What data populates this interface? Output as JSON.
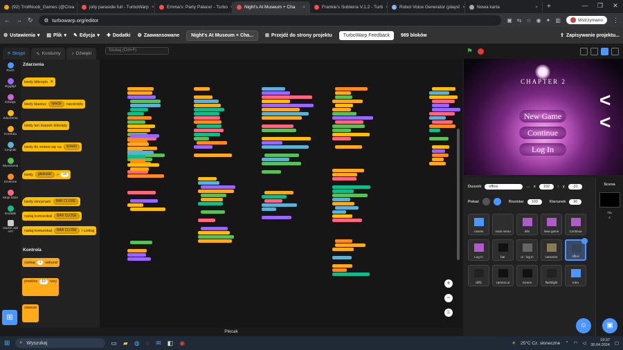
{
  "browser": {
    "tabs": [
      {
        "label": "(92) TrollNoob_Games (@Crea",
        "color": "#f4a300"
      },
      {
        "label": "jolly paraside full - TurboWarp",
        "color": "#ff4c4c"
      },
      {
        "label": "Emma's: Party Palace! - Turbo",
        "color": "#ff4c4c"
      },
      {
        "label": "Night's At Museum + Cha",
        "color": "#ff4c4c"
      },
      {
        "label": "Frankie's Subterra V.1.2 - Turb",
        "color": "#ff4c4c"
      },
      {
        "label": "Robot Voice Generator (playst",
        "color": "#8ab4f8"
      },
      {
        "label": "Nowa karta",
        "color": "#aaaaaa"
      }
    ],
    "tab_close": "×",
    "new_tab": "+",
    "url": "turbowarp.org/editor",
    "profile_label": "Wstrzymano",
    "window_controls": [
      "—",
      "❐",
      "✕"
    ]
  },
  "menubar": {
    "settings": "Ustawienia",
    "file": "Plik",
    "edit": "Edycja",
    "addons": "Dodatki",
    "advanced": "Zaawansowane",
    "project_title": "Night's At Museum + Cha...",
    "project_page": "Przejdź do strony projektu",
    "feedback": "TurboWarp Feedback",
    "block_count": "989 bloków",
    "save": "Zapisywanie projektu..."
  },
  "editor_tabs": {
    "code": "Skrypt",
    "costumes": "Kostiumy",
    "sounds": "Dźwięki"
  },
  "search_placeholder": "Szukaj (Ctrl+F)",
  "categories": [
    {
      "label": "Ruch",
      "color": "#4c97ff"
    },
    {
      "label": "Wygląd",
      "color": "#9966ff"
    },
    {
      "label": "Dźwięk",
      "color": "#cf63cf"
    },
    {
      "label": "Zdarzenia",
      "color": "#ffbf00"
    },
    {
      "label": "Kontrola",
      "color": "#ffab19"
    },
    {
      "label": "Czujniki",
      "color": "#5cb1d6"
    },
    {
      "label": "Wyrażenia",
      "color": "#59c059"
    },
    {
      "label": "Zmienne",
      "color": "#ff8c1a"
    },
    {
      "label": "Moje bloki",
      "color": "#ff6680"
    },
    {
      "label": "Dodatki",
      "color": "#0fbd8c"
    },
    {
      "label": "Game Jolt API",
      "color": "#cccccc"
    }
  ],
  "palette": {
    "events_title": "Zdarzenia",
    "control_title": "Kontrola",
    "when_flag": "kiedy kliknięto",
    "when_key": "kiedy klawisz",
    "key_value": "spacja",
    "key_pressed": "naciśnięty",
    "when_sprite_clicked": "kiedy ten duszek kliknięty",
    "when_backdrop": "kiedy tło zmieni się na",
    "backdrop_value": "screen",
    "when_greater": "kiedy",
    "loudness": "głośność",
    "greater_sign": ">",
    "greater_value": "10",
    "when_receive": "kiedy otrzymam",
    "broadcast_value": "BAR CLOSE",
    "broadcast": "nadaj komunikat",
    "broadcast_wait": "nadaj komunikat",
    "and_wait": "i czekaj",
    "wait": "czekaj",
    "wait_value": "1",
    "seconds": "sekund",
    "repeat": "powtórz",
    "repeat_value": "10",
    "times": "razy",
    "forever": "zawsze"
  },
  "stage": {
    "chapter": "CHAPTER 2",
    "new_game": "New Game",
    "continue": "Continue",
    "login": "Log In",
    "chevrons": [
      "<",
      "<"
    ]
  },
  "sprite_info": {
    "sprite_label": "Duszek",
    "sprite_name": "office",
    "x_label": "x",
    "x_value": "102",
    "y_label": "y",
    "y_value": "-31",
    "show_label": "Pokaż",
    "size_label": "Rozmiar",
    "size_value": "100",
    "direction_label": "Kierunek",
    "direction_value": "90"
  },
  "sprites": [
    {
      "name": "Assets",
      "color": "#4c97ff",
      "selected": false
    },
    {
      "name": "main menu",
      "color": "#2e2e2e",
      "selected": false
    },
    {
      "name": "title",
      "color": "#b05cc8",
      "selected": false
    },
    {
      "name": "New game",
      "color": "#b05cc8",
      "selected": false
    },
    {
      "name": "Continue",
      "color": "#b05cc8",
      "selected": false
    },
    {
      "name": "Log In",
      "color": "#b05cc8",
      "selected": false
    },
    {
      "name": "bar",
      "color": "#111111",
      "selected": false
    },
    {
      "name": "ui - log in",
      "color": "#666666",
      "selected": false
    },
    {
      "name": "cutscene",
      "color": "#8a7a5a",
      "selected": false
    },
    {
      "name": "office",
      "color": "#334455",
      "selected": true
    },
    {
      "name": "cliff1",
      "color": "#222222",
      "selected": false
    },
    {
      "name": "camera ui",
      "color": "#111111",
      "selected": false
    },
    {
      "name": "screen",
      "color": "#111111",
      "selected": false
    },
    {
      "name": "flashlight",
      "color": "#222222",
      "selected": false
    },
    {
      "name": "Intro",
      "color": "#4c97ff",
      "selected": false
    }
  ],
  "scene": {
    "label": "Scena",
    "backdrops_label": "Tła",
    "backdrops_count": "4"
  },
  "backpack": "Plecak",
  "taskbar": {
    "search": "Wyszukaj",
    "weather": "25°C  Cz. słoneczne",
    "time": "19:37",
    "date": "30.04.2024"
  }
}
